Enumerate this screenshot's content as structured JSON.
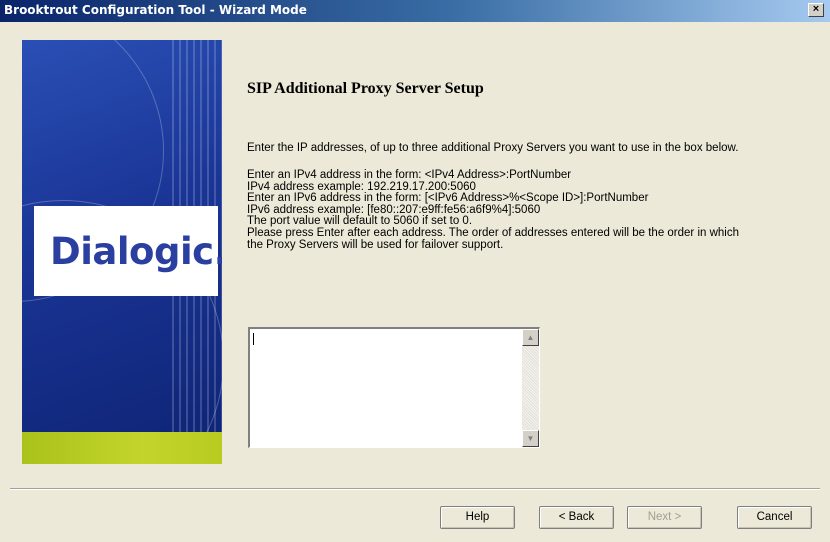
{
  "window": {
    "title": "Brooktrout Configuration Tool - Wizard Mode",
    "close_label": "×"
  },
  "banner": {
    "logo_text": "Dialogic.",
    "colors": {
      "blue": "#1a3596",
      "green": "#b7cb20"
    }
  },
  "page": {
    "heading": "SIP Additional Proxy Server Setup",
    "intro": "Enter the IP addresses, of up to three additional Proxy Servers you want to use in the box below.",
    "instructions": [
      "Enter an IPv4 address in the form: <IPv4 Address>:PortNumber",
      "IPv4 address example:  192.219.17.200:5060",
      "Enter an IPv6 address in the form: [<IPv6 Address>%<Scope ID>]:PortNumber",
      "IPv6 address example:  [fe80::207:e9ff:fe56:a6f9%4]:5060",
      "The port value will default to 5060 if set to 0.",
      "Please press Enter after each address. The order of addresses entered will be the order in which",
      "the Proxy Servers will be used for failover support."
    ]
  },
  "proxy_input": {
    "value": "",
    "scroll_up_icon": "▲",
    "scroll_down_icon": "▼"
  },
  "buttons": {
    "help": "Help",
    "back": "< Back",
    "next": "Next >",
    "cancel": "Cancel"
  }
}
